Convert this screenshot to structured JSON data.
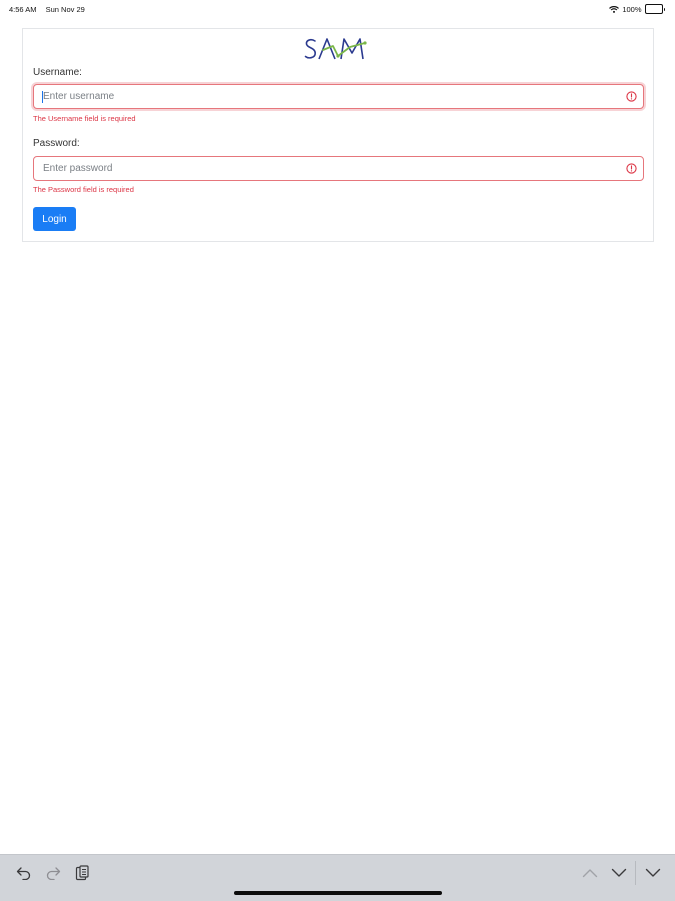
{
  "status_bar": {
    "time": "4:56 AM",
    "date": "Sun Nov 29",
    "battery_percent": "100%",
    "icons": [
      "wifi-icon",
      "battery-icon"
    ]
  },
  "brand": {
    "logo_text": "SAM",
    "logo_colors": {
      "letters": "#2b3a8f",
      "accent": "#7ab648"
    }
  },
  "form": {
    "username": {
      "label": "Username:",
      "placeholder": "Enter username",
      "value": "",
      "error": "The Username field is required",
      "focused": true
    },
    "password": {
      "label": "Password:",
      "placeholder": "Enter password",
      "value": "",
      "error": "The Password field is required",
      "focused": false
    },
    "login_label": "Login"
  },
  "toolbar": {
    "left_icons": [
      "undo-icon",
      "redo-icon",
      "paste-icon"
    ],
    "right_icons": [
      "chevron-up-icon",
      "chevron-down-icon",
      "dismiss-keyboard-icon"
    ]
  },
  "colors": {
    "primary": "#1a7df5",
    "error": "#dc3545",
    "error_border": "#e6767c",
    "toolbar_bg": "#d1d4d9"
  }
}
